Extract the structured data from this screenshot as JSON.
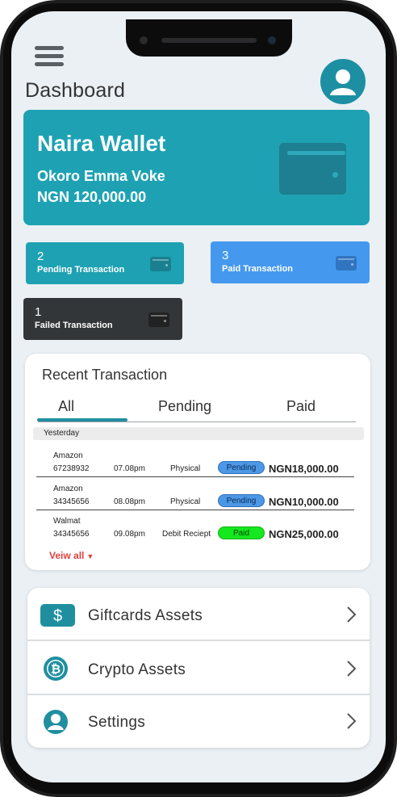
{
  "header": {
    "title": "Dashboard"
  },
  "wallet": {
    "title": "Naira Wallet",
    "owner": "Okoro Emma Voke",
    "balance": "NGN 120,000.00"
  },
  "stats": {
    "pending": {
      "count": "2",
      "label": "Pending Transaction"
    },
    "paid": {
      "count": "3",
      "label": "Paid Transaction"
    },
    "failed": {
      "count": "1",
      "label": "Failed Transaction"
    }
  },
  "recent": {
    "title": "Recent Transaction",
    "tabs": [
      "All",
      "Pending",
      "Paid"
    ],
    "section_label": "Yesterday",
    "transactions": [
      {
        "merchant": "Amazon",
        "id": "67238932",
        "time": "07.08pm",
        "type": "Physical",
        "status": "Pending",
        "amount": "NGN18,000.00"
      },
      {
        "merchant": "Amazon",
        "id": "34345656",
        "time": "08.08pm",
        "type": "Physical",
        "status": "Pending",
        "amount": "NGN10,000.00"
      },
      {
        "merchant": "Walmat",
        "id": "34345656",
        "time": "09.08pm",
        "type": "Debit Reciept",
        "status": "Paid",
        "amount": "NGN25,000.00"
      }
    ],
    "view_all": "Veiw all"
  },
  "menu": {
    "items": [
      {
        "label": "Giftcards Assets",
        "icon": "dollar-icon"
      },
      {
        "label": "Crypto  Assets",
        "icon": "bitcoin-icon"
      },
      {
        "label": "Settings",
        "icon": "user-settings-icon"
      }
    ]
  },
  "colors": {
    "accent_teal": "#1ea2b3",
    "paid_blue": "#4499ef",
    "failed_dark": "#333638",
    "status_pending": "#4c98e6",
    "status_paid": "#14e81e",
    "link_red": "#e23e3e"
  }
}
